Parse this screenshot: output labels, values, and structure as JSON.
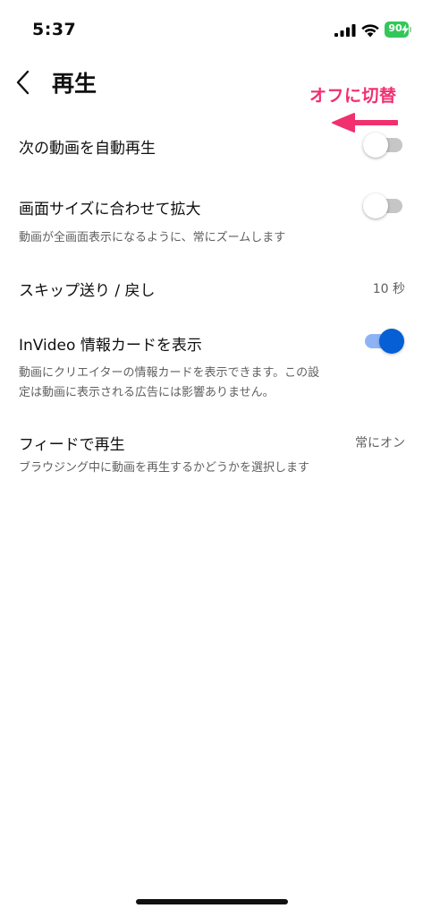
{
  "status_bar": {
    "time": "5:37",
    "battery_level": "90",
    "icons": [
      "signal-icon",
      "wifi-icon",
      "battery-icon"
    ]
  },
  "header": {
    "title": "再生",
    "back_icon": "chevron-left-icon"
  },
  "annotation": {
    "text": "オフに切替",
    "color": "#f0306f"
  },
  "settings": [
    {
      "label": "次の動画を自動再生",
      "toggle": "off"
    },
    {
      "label": "画面サイズに合わせて拡大",
      "toggle": "off",
      "description": "動画が全画面表示になるように、常にズームします"
    },
    {
      "label": "スキップ送り / 戻し",
      "value": "10 秒"
    },
    {
      "label": "InVideo 情報カードを表示",
      "toggle": "on",
      "description_lines": [
        "動画にクリエイターの情報カードを表示できます。この設",
        "定は動画に表示される広告には影響ありません。"
      ]
    },
    {
      "label": "フィードで再生",
      "value": "常にオン",
      "description": "ブラウジング中に動画を再生するかどうかを選択します"
    }
  ],
  "colors": {
    "toggle_on": "#065fd4",
    "toggle_on_track": "#8eb3f5",
    "toggle_off_track": "#c6c6c6",
    "battery": "#33c759"
  }
}
